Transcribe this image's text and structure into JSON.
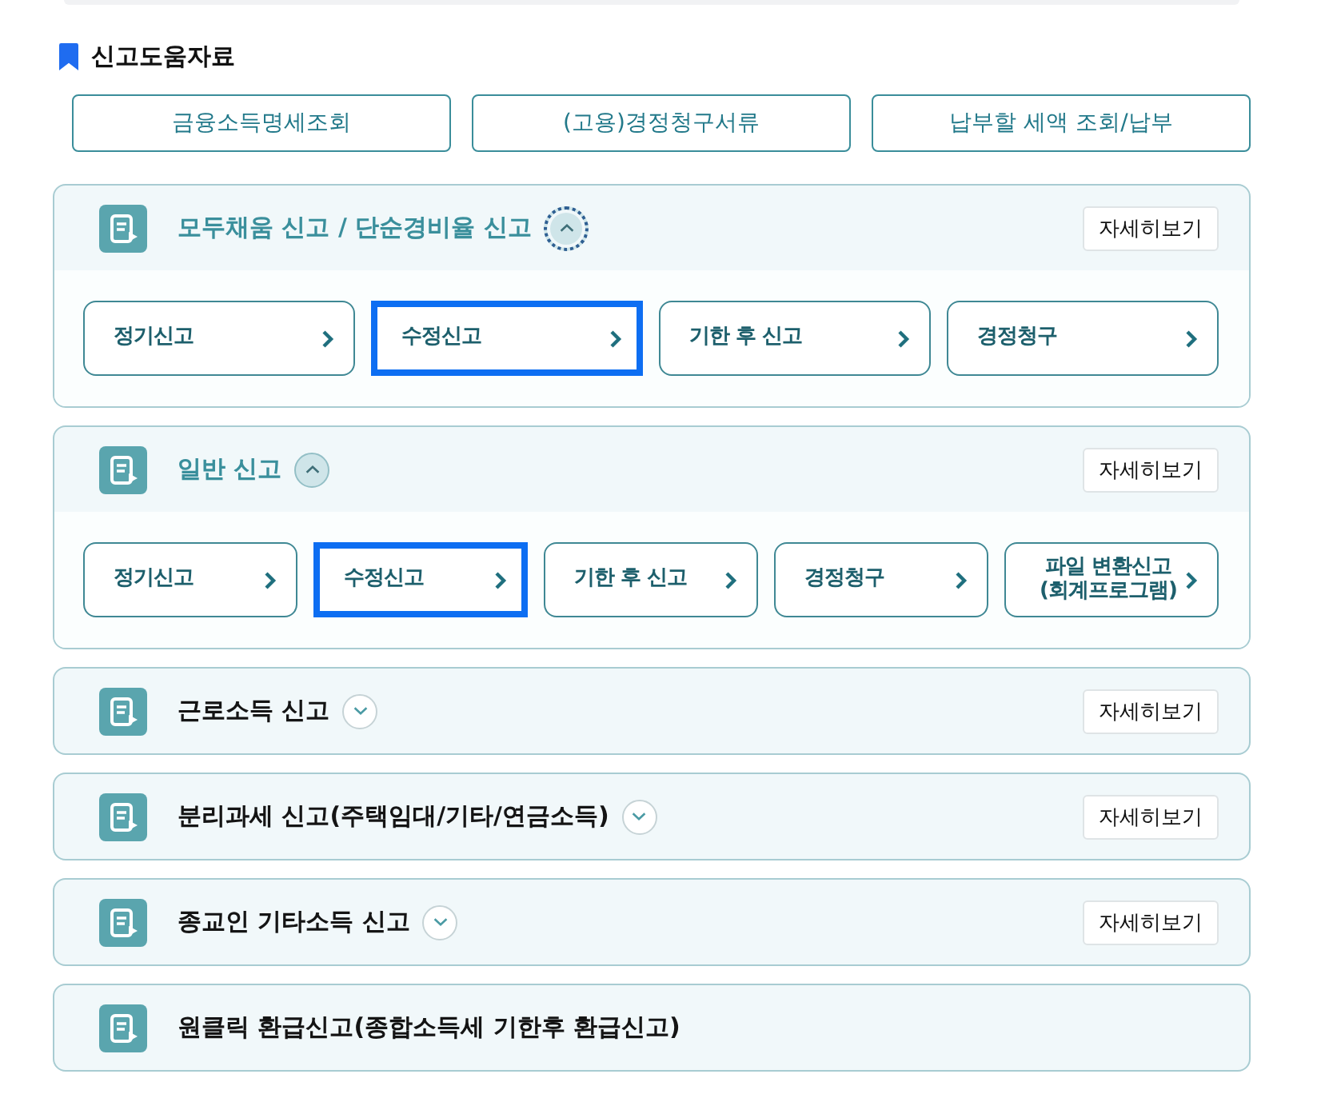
{
  "section": {
    "title": "신고도움자료"
  },
  "help_buttons": [
    "금융소득명세조회",
    "(고용)경정청구서류",
    "납부할 세액 조회/납부"
  ],
  "panels": [
    {
      "title": "모두채움 신고 / 단순경비율 신고",
      "toggle": {
        "expanded": true,
        "focused": true
      },
      "detail_button": "자세히보기",
      "options": [
        {
          "label": "정기신고",
          "selected": false
        },
        {
          "label": "수정신고",
          "selected": true
        },
        {
          "label": "기한 후 신고",
          "selected": false
        },
        {
          "label": "경정청구",
          "selected": false
        }
      ]
    },
    {
      "title": "일반 신고",
      "toggle": {
        "expanded": true,
        "focused": false
      },
      "detail_button": "자세히보기",
      "options": [
        {
          "label": "정기신고",
          "selected": false
        },
        {
          "label": "수정신고",
          "selected": true
        },
        {
          "label": "기한 후 신고",
          "selected": false
        },
        {
          "label": "경정청구",
          "selected": false
        },
        {
          "label": "파일 변환신고 (회계프로그램)",
          "selected": false
        }
      ]
    },
    {
      "title": "근로소득 신고",
      "toggle": {
        "expanded": false,
        "focused": false
      },
      "detail_button": "자세히보기"
    },
    {
      "title": "분리과세 신고(주택임대/기타/연금소득)",
      "toggle": {
        "expanded": false,
        "focused": false
      },
      "detail_button": "자세히보기"
    },
    {
      "title": "종교인 기타소득 신고",
      "toggle": {
        "expanded": false,
        "focused": false
      },
      "detail_button": "자세히보기"
    },
    {
      "title": "원클릭 환급신고(종합소득세 기한후 환급신고)"
    }
  ]
}
